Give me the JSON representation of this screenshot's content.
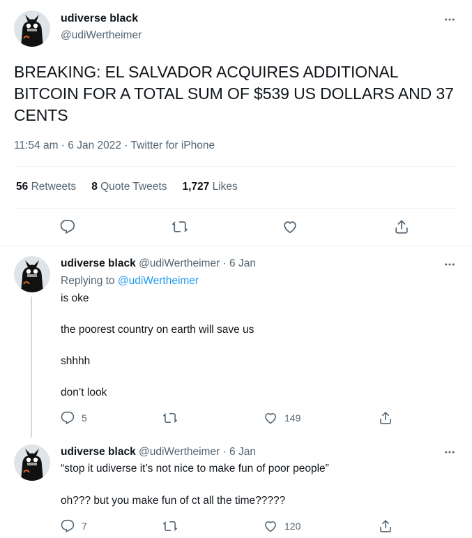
{
  "main_tweet": {
    "name": "udiverse black",
    "handle": "@udiWertheimer",
    "text": "BREAKING: EL SALVADOR ACQUIRES ADDITIONAL BITCOIN FOR A TOTAL SUM OF $539 US DOLLARS AND 37 CENTS",
    "time": "11:54 am",
    "date": "6 Jan 2022",
    "source": "Twitter for iPhone",
    "dot": "·",
    "stats": {
      "retweets_count": "56",
      "retweets_label": "Retweets",
      "quotes_count": "8",
      "quotes_label": "Quote Tweets",
      "likes_count": "1,727",
      "likes_label": "Likes"
    }
  },
  "reply1": {
    "name": "udiverse black",
    "handle": "@udiWertheimer",
    "date": "· 6 Jan",
    "replying_prefix": "Replying to",
    "replying_handle": "@udiWertheimer",
    "lines": [
      "is oke",
      "the poorest country on earth will save us",
      "shhhh",
      "don’t look"
    ],
    "reply_count": "5",
    "retweet_count": "",
    "like_count": "149"
  },
  "reply2": {
    "name": "udiverse black",
    "handle": "@udiWertheimer",
    "date": "· 6 Jan",
    "lines": [
      "“stop it udiverse it’s not nice to make fun of poor people”",
      "oh??? but you make fun of ct all the time?????"
    ],
    "reply_count": "7",
    "retweet_count": "",
    "like_count": "120"
  },
  "icons": {
    "avatar": "black-cat-avatar",
    "more": "more-dots-icon",
    "reply": "reply-icon",
    "retweet": "retweet-icon",
    "like": "heart-icon",
    "share": "share-icon"
  },
  "colors": {
    "text": "#0f1419",
    "secondary": "#536471",
    "link": "#1d9bf0",
    "divider": "#eff3f4"
  }
}
